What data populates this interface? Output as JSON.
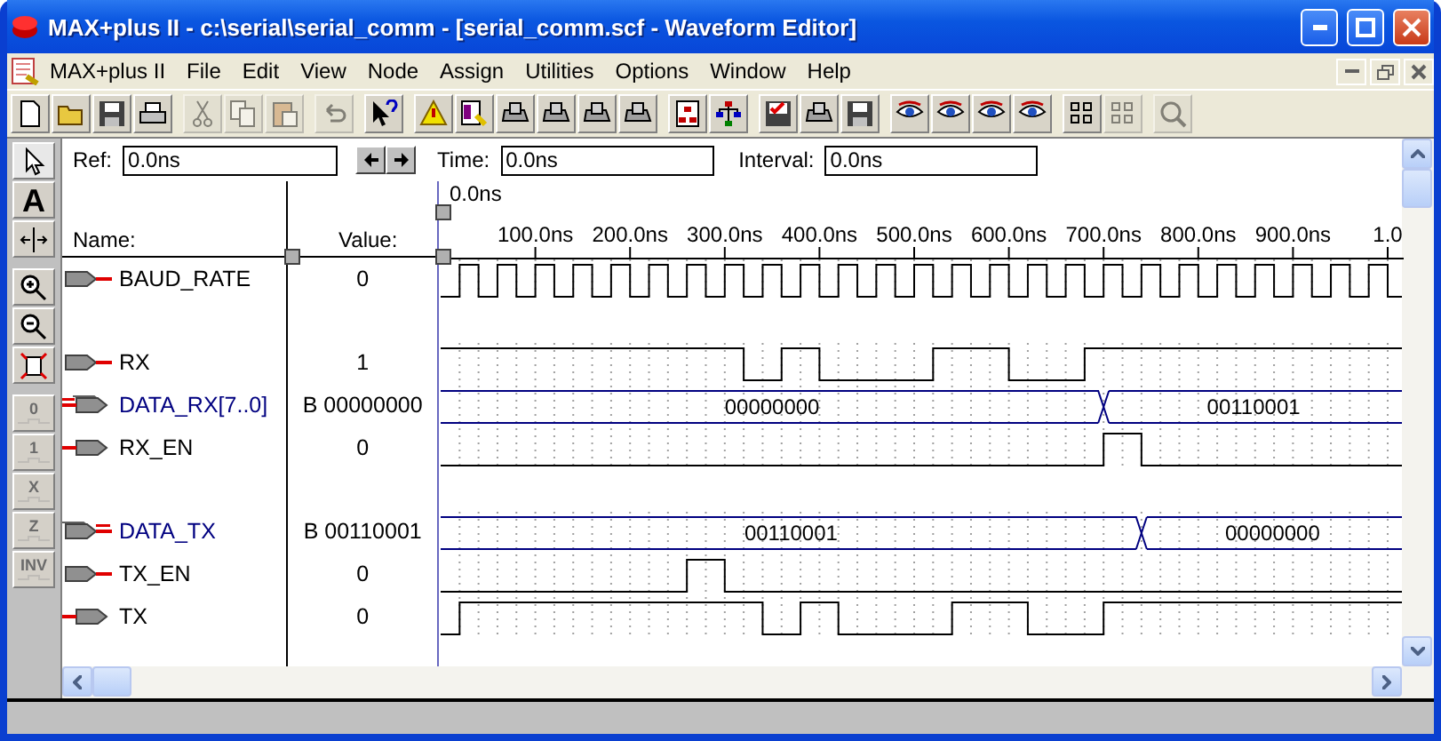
{
  "window": {
    "title": "MAX+plus II - c:\\serial\\serial_comm - [serial_comm.scf - Waveform Editor]"
  },
  "menu": [
    "MAX+plus II",
    "File",
    "Edit",
    "View",
    "Node",
    "Assign",
    "Utilities",
    "Options",
    "Window",
    "Help"
  ],
  "toolbar": [
    [
      {
        "kind": "document",
        "disabled": false
      },
      {
        "kind": "folder",
        "disabled": false
      },
      {
        "kind": "floppy",
        "disabled": false
      },
      {
        "kind": "printer",
        "disabled": false
      }
    ],
    [
      {
        "kind": "scissors",
        "disabled": true
      },
      {
        "kind": "copy",
        "disabled": true
      },
      {
        "kind": "clipboard",
        "disabled": true
      }
    ],
    [
      {
        "kind": "undo",
        "disabled": true
      }
    ],
    [
      {
        "kind": "help",
        "disabled": false
      }
    ],
    [
      {
        "kind": "warning",
        "disabled": false
      },
      {
        "kind": "doc-pencil",
        "disabled": false
      },
      {
        "kind": "device",
        "disabled": false
      },
      {
        "kind": "device",
        "disabled": false
      },
      {
        "kind": "device",
        "disabled": false
      },
      {
        "kind": "device",
        "disabled": false
      }
    ],
    [
      {
        "kind": "doc-tree",
        "disabled": false
      },
      {
        "kind": "tree",
        "disabled": false
      }
    ],
    [
      {
        "kind": "check-disk",
        "disabled": false
      },
      {
        "kind": "device",
        "disabled": false
      },
      {
        "kind": "floppy",
        "disabled": false
      }
    ],
    [
      {
        "kind": "eye",
        "disabled": false
      },
      {
        "kind": "eye",
        "disabled": false
      },
      {
        "kind": "eye",
        "disabled": false
      },
      {
        "kind": "eye",
        "disabled": false
      }
    ],
    [
      {
        "kind": "grid",
        "disabled": false
      },
      {
        "kind": "grid",
        "disabled": true
      }
    ],
    [
      {
        "kind": "magnifier",
        "disabled": true
      }
    ]
  ],
  "side_tools": [
    [
      {
        "kind": "pointer",
        "disabled": false,
        "selected": true
      },
      {
        "kind": "text",
        "label": "A",
        "disabled": false,
        "selected": false
      },
      {
        "kind": "expand",
        "disabled": false,
        "selected": false
      }
    ],
    [
      {
        "kind": "zoom-in",
        "disabled": false,
        "selected": false
      },
      {
        "kind": "zoom-out",
        "disabled": false,
        "selected": false
      },
      {
        "kind": "fit",
        "disabled": false,
        "selected": false
      }
    ],
    [
      {
        "kind": "level",
        "label": "0",
        "disabled": true,
        "selected": false
      },
      {
        "kind": "level",
        "label": "1",
        "disabled": true,
        "selected": false
      },
      {
        "kind": "level",
        "label": "X",
        "disabled": true,
        "selected": false
      },
      {
        "kind": "level",
        "label": "Z",
        "disabled": true,
        "selected": false
      },
      {
        "kind": "level",
        "label": "INV",
        "disabled": true,
        "selected": false
      }
    ]
  ],
  "ref": {
    "label": "Ref:",
    "value": "0.0ns"
  },
  "time": {
    "label": "Time:",
    "value": "0.0ns"
  },
  "interval": {
    "label": "Interval:",
    "value": "0.0ns"
  },
  "columns": {
    "name": "Name:",
    "value": "Value:"
  },
  "cursor_label": "0.0ns",
  "ruler": [
    "100.0ns",
    "200.0ns",
    "300.0ns",
    "400.0ns",
    "500.0ns",
    "600.0ns",
    "700.0ns",
    "800.0ns",
    "900.0ns",
    "1.0"
  ],
  "signal_groups": [
    [
      {
        "name": "BAUD_RATE",
        "value": "0",
        "output": false,
        "kind": "clock"
      }
    ],
    [
      {
        "name": "RX",
        "value": "1",
        "output": false,
        "kind": "bit"
      },
      {
        "name": "DATA_RX[7..0]",
        "value": "B 00000000",
        "output": true,
        "kind": "bus",
        "values": [
          "00000000",
          "00110001"
        ]
      },
      {
        "name": "RX_EN",
        "value": "0",
        "output": true,
        "kind": "bit"
      }
    ],
    [
      {
        "name": "DATA_TX",
        "value": "B 00110001",
        "output": false,
        "kind": "bus",
        "values": [
          "00110001",
          "00000000"
        ]
      },
      {
        "name": "TX_EN",
        "value": "0",
        "output": false,
        "kind": "bit"
      },
      {
        "name": "TX",
        "value": "0",
        "output": true,
        "kind": "bit"
      }
    ]
  ]
}
